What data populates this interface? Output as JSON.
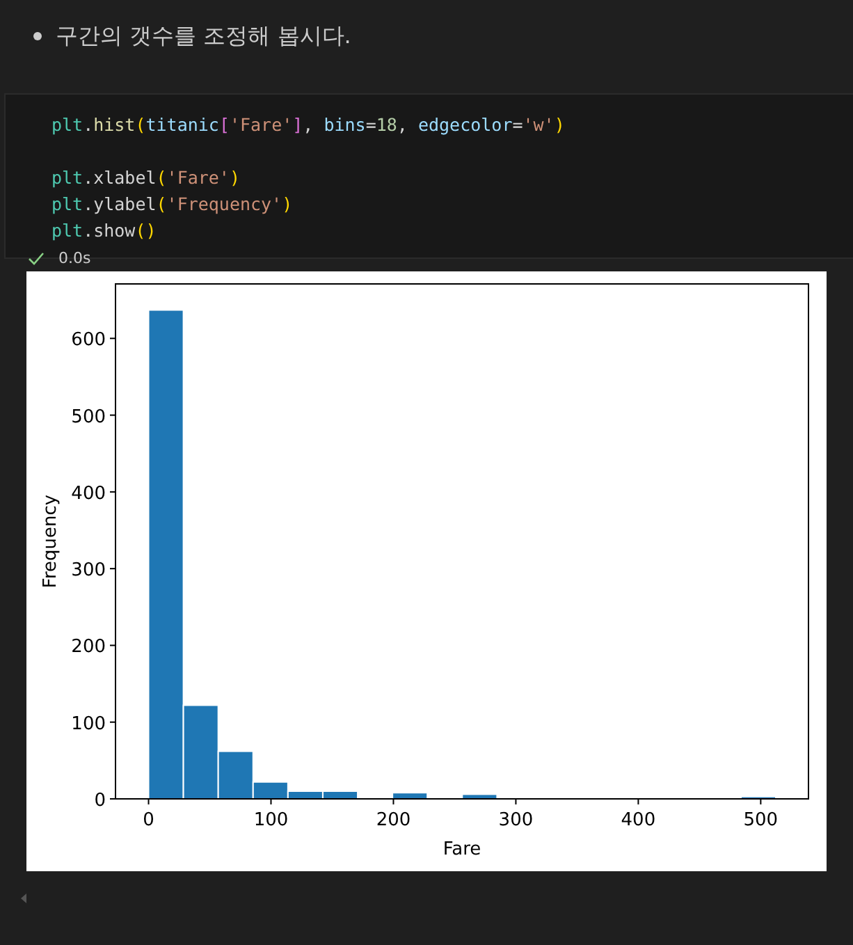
{
  "bullet": {
    "text": "구간의 갯수를 조정해 봅시다."
  },
  "cell": {
    "lines": [
      {
        "gap_after": true,
        "tokens": [
          {
            "text": "plt",
            "kind": "module"
          },
          {
            "text": ".",
            "kind": "plain"
          },
          {
            "text": "hist",
            "kind": "func"
          },
          {
            "text": "(",
            "kind": "paren"
          },
          {
            "text": "titanic",
            "kind": "var"
          },
          {
            "text": "[",
            "kind": "bracket"
          },
          {
            "text": "'Fare'",
            "kind": "string"
          },
          {
            "text": "]",
            "kind": "bracket"
          },
          {
            "text": ", ",
            "kind": "plain"
          },
          {
            "text": "bins",
            "kind": "var"
          },
          {
            "text": "=",
            "kind": "plain"
          },
          {
            "text": "18",
            "kind": "number"
          },
          {
            "text": ", ",
            "kind": "plain"
          },
          {
            "text": "edgecolor",
            "kind": "var"
          },
          {
            "text": "=",
            "kind": "plain"
          },
          {
            "text": "'w'",
            "kind": "string"
          },
          {
            "text": ")",
            "kind": "paren"
          }
        ]
      },
      {
        "gap_after": false,
        "tokens": [
          {
            "text": "plt",
            "kind": "module"
          },
          {
            "text": ".xlabel",
            "kind": "plain"
          },
          {
            "text": "(",
            "kind": "paren"
          },
          {
            "text": "'Fare'",
            "kind": "string"
          },
          {
            "text": ")",
            "kind": "paren"
          }
        ]
      },
      {
        "gap_after": false,
        "tokens": [
          {
            "text": "plt",
            "kind": "module"
          },
          {
            "text": ".ylabel",
            "kind": "plain"
          },
          {
            "text": "(",
            "kind": "paren"
          },
          {
            "text": "'Frequency'",
            "kind": "string"
          },
          {
            "text": ")",
            "kind": "paren"
          }
        ]
      },
      {
        "gap_after": false,
        "tokens": [
          {
            "text": "plt",
            "kind": "module"
          },
          {
            "text": ".show",
            "kind": "plain"
          },
          {
            "text": "()",
            "kind": "paren"
          }
        ]
      }
    ],
    "status": {
      "succeeded": true,
      "time": "0.0s"
    }
  },
  "output": {
    "chart_data": {
      "type": "bar",
      "xlabel": "Fare",
      "ylabel": "Frequency",
      "x": [
        14.23,
        42.69,
        71.16,
        99.62,
        128.08,
        156.55,
        185.01,
        213.47,
        241.93,
        270.4,
        298.86,
        327.32,
        355.78,
        384.25,
        412.71,
        441.17,
        469.63,
        498.1
      ],
      "values": [
        637,
        122,
        62,
        22,
        10,
        10,
        0,
        8,
        0,
        6,
        0,
        0,
        0,
        0,
        0,
        0,
        0,
        3
      ],
      "xlim": [
        -27,
        539
      ],
      "ylim": [
        0,
        671
      ],
      "xticks": [
        0,
        100,
        200,
        300,
        400,
        500
      ],
      "yticks": [
        0,
        100,
        200,
        300,
        400,
        500,
        600
      ]
    }
  }
}
